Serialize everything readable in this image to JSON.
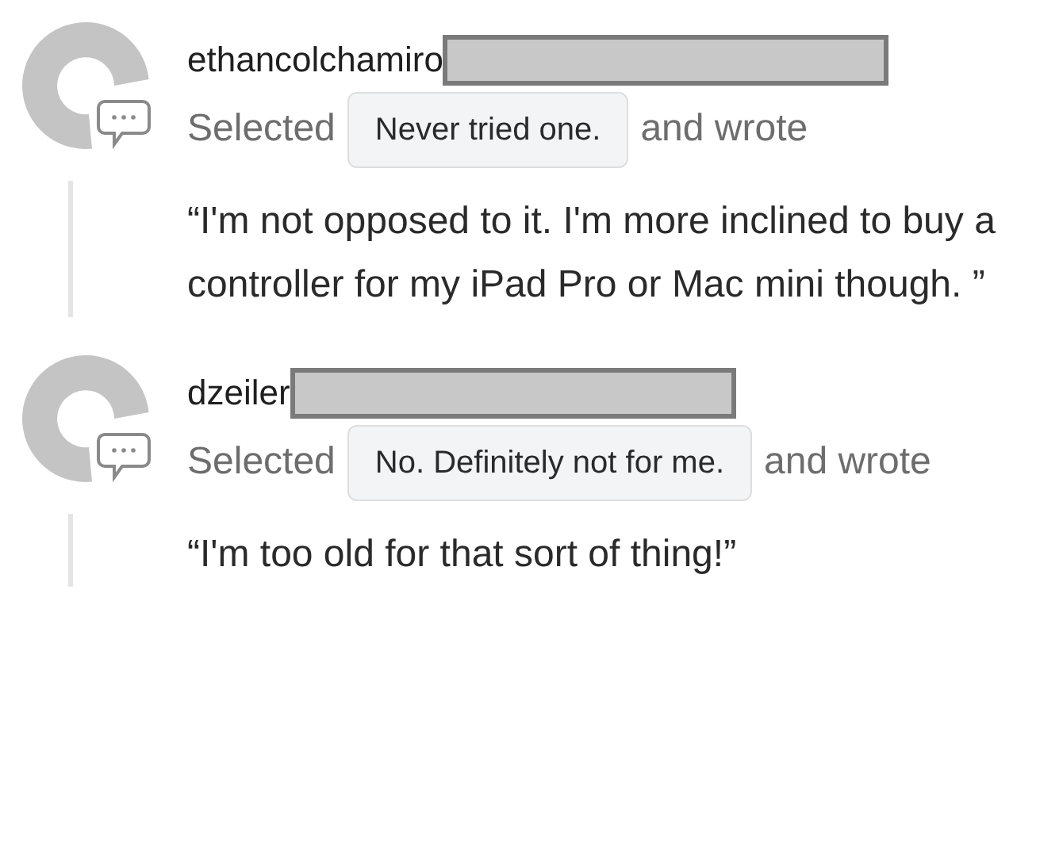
{
  "responses": [
    {
      "username": "ethancolchamiro",
      "redacted": true,
      "lead": "Selected",
      "answer": "Never tried one.",
      "trail": "and wrote",
      "quote": "“I'm not opposed to it. I'm more inclined to buy a controller for my iPad Pro or Mac mini though. ”"
    },
    {
      "username": "dzeiler",
      "redacted": true,
      "lead": "Selected",
      "answer": "No. Definitely not for me.",
      "trail": "and wrote",
      "quote": "“I'm too old for that sort of thing!”"
    }
  ]
}
